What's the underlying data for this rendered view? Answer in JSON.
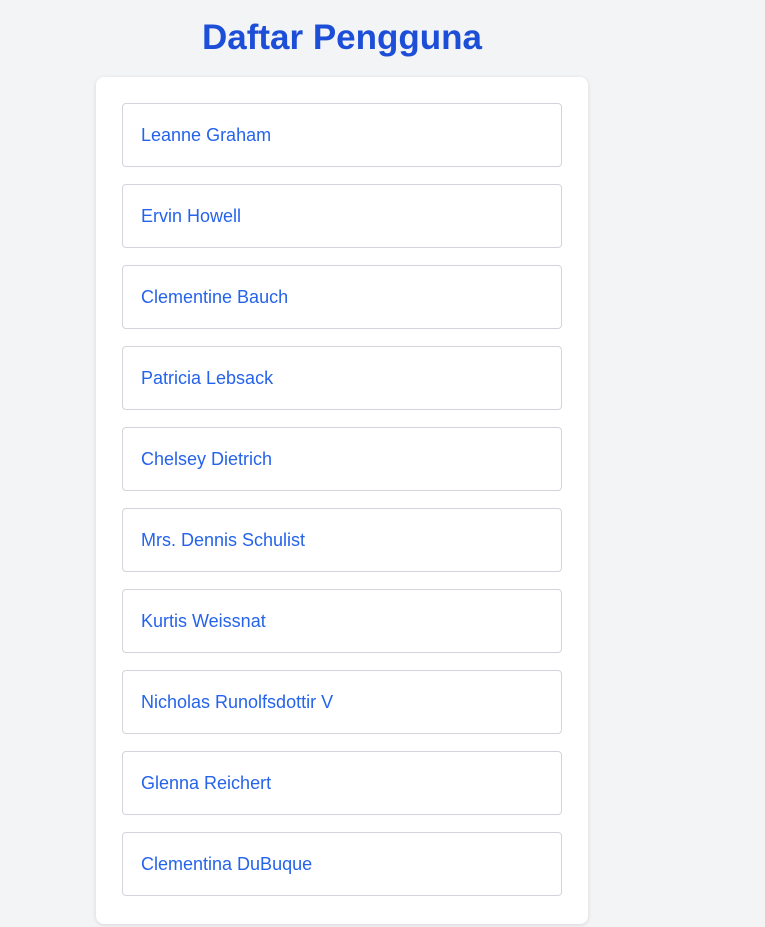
{
  "header": {
    "title": "Daftar Pengguna"
  },
  "colors": {
    "title": "#1d4ed8",
    "link": "#2563eb",
    "background": "#f3f4f6",
    "card": "#ffffff",
    "border": "#d1d5db"
  },
  "users": [
    {
      "name": "Leanne Graham"
    },
    {
      "name": "Ervin Howell"
    },
    {
      "name": "Clementine Bauch"
    },
    {
      "name": "Patricia Lebsack"
    },
    {
      "name": "Chelsey Dietrich"
    },
    {
      "name": "Mrs. Dennis Schulist"
    },
    {
      "name": "Kurtis Weissnat"
    },
    {
      "name": "Nicholas Runolfsdottir V"
    },
    {
      "name": "Glenna Reichert"
    },
    {
      "name": "Clementina DuBuque"
    }
  ]
}
